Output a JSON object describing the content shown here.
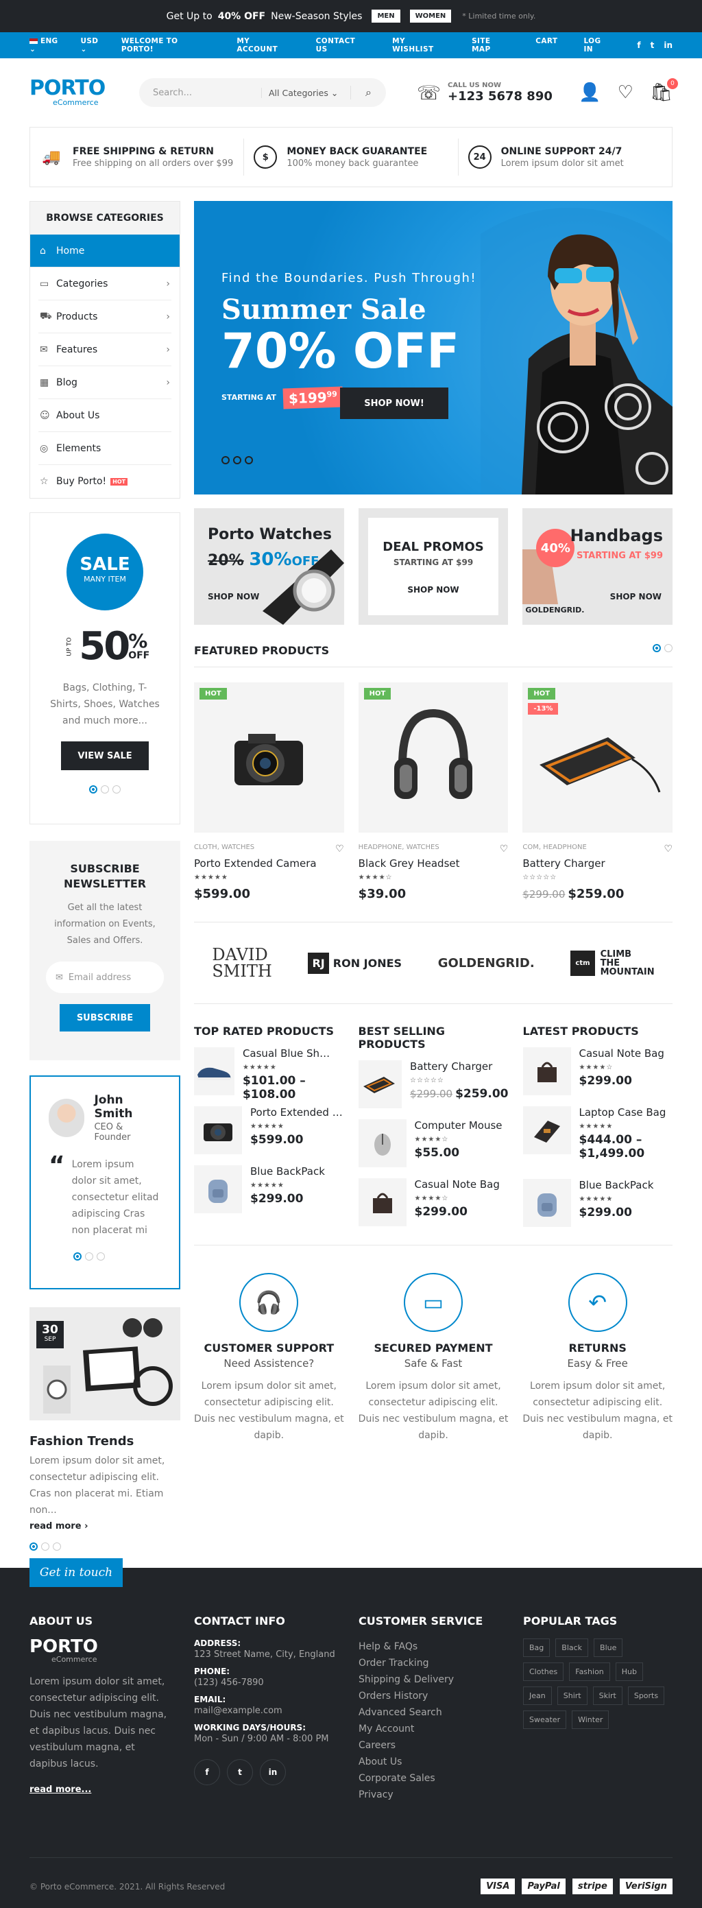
{
  "promo": {
    "lead": "Get Up to",
    "pct": "40% OFF",
    "rest": "New-Season Styles",
    "btn_men": "MEN",
    "btn_women": "WOMEN",
    "note": "* Limited time only."
  },
  "topbar": {
    "lang": "ENG",
    "currency": "USD",
    "welcome": "WELCOME TO PORTO!",
    "nav": [
      "MY ACCOUNT",
      "CONTACT US",
      "MY WISHLIST",
      "SITE MAP",
      "CART",
      "LOG IN"
    ],
    "social": [
      "f",
      "t",
      "in"
    ]
  },
  "header": {
    "logo": "PORTO",
    "logo_sub": "eCommerce",
    "search_placeholder": "Search...",
    "search_cat": "All Categories",
    "call_label": "CALL US NOW",
    "phone": "+123 5678 890",
    "cart_count": "0"
  },
  "info": [
    {
      "icon": "truck-icon",
      "title": "FREE SHIPPING & RETURN",
      "desc": "Free shipping on all orders over $99",
      "glyph": "🚚"
    },
    {
      "icon": "dollar-icon",
      "title": "MONEY BACK GUARANTEE",
      "desc": "100% money back guarantee",
      "glyph": "$"
    },
    {
      "icon": "support-24-icon",
      "title": "ONLINE SUPPORT 24/7",
      "desc": "Lorem ipsum dolor sit amet",
      "glyph": "24"
    }
  ],
  "categories": {
    "title": "BROWSE CATEGORIES",
    "items": [
      {
        "label": "Home",
        "glyph": "⌂",
        "arrow": ""
      },
      {
        "label": "Categories",
        "glyph": "▭",
        "arrow": "›"
      },
      {
        "label": "Products",
        "glyph": "⛟",
        "arrow": "›"
      },
      {
        "label": "Features",
        "glyph": "✉",
        "arrow": "›"
      },
      {
        "label": "Blog",
        "glyph": "▦",
        "arrow": "›"
      },
      {
        "label": "About Us",
        "glyph": "☺",
        "arrow": ""
      },
      {
        "label": "Elements",
        "glyph": "◎",
        "arrow": ""
      },
      {
        "label": "Buy Porto!",
        "glyph": "☆",
        "arrow": "",
        "badge": "HOT"
      }
    ]
  },
  "hero": {
    "sub": "Find the Boundaries. Push Through!",
    "title1": "Summer Sale",
    "title2": "70% OFF",
    "starting": "STARTING AT",
    "price": "$199",
    "price_cents": "99",
    "button": "SHOP NOW!"
  },
  "sale": {
    "badge1": "SALE",
    "badge2": "MANY ITEM",
    "upto": "UP TO",
    "big": "50",
    "pct": "%",
    "off": "OFF",
    "text": "Bags, Clothing, T-Shirts, Shoes, Watches and much more...",
    "button": "VIEW SALE"
  },
  "banners": [
    {
      "title": "Porto Watches",
      "old": "20%",
      "new": "30%",
      "off": "OFF",
      "btn": "SHOP NOW"
    },
    {
      "title": "DEAL PROMOS",
      "sub": "STARTING AT $99",
      "btn": "SHOP NOW"
    },
    {
      "title": "Handbags",
      "sub": "STARTING AT $99",
      "badge": "40%",
      "brand": "GOLDENGRID.",
      "btn": "SHOP NOW"
    }
  ],
  "featured": {
    "title": "FEATURED PRODUCTS",
    "items": [
      {
        "tag": "HOT",
        "cat": "CLOTH, WATCHES",
        "name": "Porto Extended Camera",
        "stars": "★★★★★",
        "price": "$599.00"
      },
      {
        "tag": "HOT",
        "cat": "HEADPHONE, WATCHES",
        "name": "Black Grey Headset",
        "stars": "★★★★☆",
        "price": "$39.00"
      },
      {
        "tag": "HOT",
        "disc": "-13%",
        "cat": "COM, HEADPHONE",
        "name": "Battery Charger",
        "stars": "☆☆☆☆☆",
        "old": "$299.00",
        "price": "$259.00"
      }
    ]
  },
  "newsletter": {
    "title": "SUBSCRIBE NEWSLETTER",
    "desc": "Get all the latest information on Events, Sales and Offers.",
    "placeholder": "Email address",
    "button": "SUBSCRIBE"
  },
  "brands": {
    "b1a": "DAVID",
    "b1b": "SMITH",
    "b2a": "RJ",
    "b2b": "RON JONES",
    "b3": "GOLDENGRID.",
    "b4a": "ctm",
    "b4b": "CLIMB",
    "b4c": "THE",
    "b4d": "MOUNTAIN"
  },
  "lists": [
    {
      "title": "TOP RATED PRODUCTS",
      "items": [
        {
          "name": "Casual Blue Shoes",
          "stars": "★★★★★",
          "price": "$101.00 – $108.00"
        },
        {
          "name": "Porto Extended Camera",
          "stars": "★★★★★",
          "price": "$599.00"
        },
        {
          "name": "Blue BackPack",
          "stars": "★★★★★",
          "price": "$299.00"
        }
      ]
    },
    {
      "title": "BEST SELLING PRODUCTS",
      "items": [
        {
          "name": "Battery Charger",
          "stars": "☆☆☆☆☆",
          "old": "$299.00",
          "price": "$259.00"
        },
        {
          "name": "Computer Mouse",
          "stars": "★★★★☆",
          "price": "$55.00"
        },
        {
          "name": "Casual Note Bag",
          "stars": "★★★★☆",
          "price": "$299.00"
        }
      ]
    },
    {
      "title": "LATEST PRODUCTS",
      "items": [
        {
          "name": "Casual Note Bag",
          "stars": "★★★★☆",
          "price": "$299.00"
        },
        {
          "name": "Laptop Case Bag",
          "stars": "★★★★★",
          "price": "$444.00 –",
          "price2": "$1,499.00"
        },
        {
          "name": "Blue BackPack",
          "stars": "★★★★★",
          "price": "$299.00"
        }
      ]
    }
  ],
  "testimonial": {
    "name": "John Smith",
    "role": "CEO & Founder",
    "text": "Lorem ipsum dolor sit amet, consectetur elitad adipiscing Cras non placerat mi"
  },
  "blog": {
    "day": "30",
    "month": "SEP",
    "title": "Fashion Trends",
    "desc": "Lorem ipsum dolor sit amet, consectetur adipiscing elit. Cras non placerat mi. Etiam non...",
    "more": "read more ›"
  },
  "services": [
    {
      "title": "CUSTOMER SUPPORT",
      "sub": "Need Assistence?",
      "desc": "Lorem ipsum dolor sit amet, consectetur adipiscing elit. Duis nec vestibulum magna, et dapib.",
      "glyph": "🎧"
    },
    {
      "title": "SECURED PAYMENT",
      "sub": "Safe & Fast",
      "desc": "Lorem ipsum dolor sit amet, consectetur adipiscing elit. Duis nec vestibulum magna, et dapib.",
      "glyph": "▭"
    },
    {
      "title": "RETURNS",
      "sub": "Easy & Free",
      "desc": "Lorem ipsum dolor sit amet, consectetur adipiscing elit. Duis nec vestibulum magna, et dapib.",
      "glyph": "↶"
    }
  ],
  "footer": {
    "tab": "Get in touch",
    "about_title": "ABOUT US",
    "logo": "PORTO",
    "logo_sub": "eCommerce",
    "about_text": "Lorem ipsum dolor sit amet, consectetur adipiscing elit. Duis nec vestibulum magna, et dapibus lacus. Duis nec vestibulum magna, et dapibus lacus.",
    "about_more": "read more...",
    "contact_title": "CONTACT INFO",
    "address_label": "ADDRESS:",
    "address": "123 Street Name, City, England",
    "phone_label": "PHONE:",
    "phone": "(123) 456-7890",
    "email_label": "EMAIL:",
    "email": "mail@example.com",
    "hours_label": "WORKING DAYS/HOURS:",
    "hours": "Mon - Sun / 9:00 AM - 8:00 PM",
    "social": [
      "f",
      "t",
      "in"
    ],
    "service_title": "CUSTOMER SERVICE",
    "service_links": [
      "Help & FAQs",
      "Order Tracking",
      "Shipping & Delivery",
      "Orders History",
      "Advanced Search",
      "My Account",
      "Careers",
      "About Us",
      "Corporate Sales",
      "Privacy"
    ],
    "tags_title": "POPULAR TAGS",
    "tags": [
      "Bag",
      "Black",
      "Blue",
      "Clothes",
      "Fashion",
      "Hub",
      "Jean",
      "Shirt",
      "Skirt",
      "Sports",
      "Sweater",
      "Winter"
    ],
    "copyright": "© Porto eCommerce. 2021. All Rights Reserved",
    "payments": [
      "VISA",
      "PayPal",
      "stripe",
      "VeriSign"
    ]
  }
}
